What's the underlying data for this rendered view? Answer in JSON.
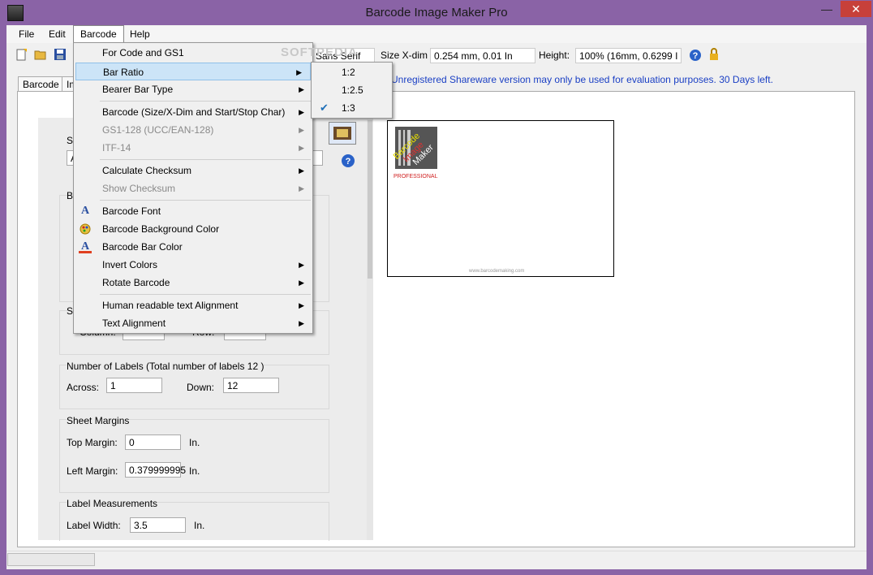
{
  "window": {
    "title": "Barcode Image Maker Pro",
    "minimize": "—",
    "maximize": "☐",
    "close": "✕"
  },
  "menubar": {
    "items": [
      "File",
      "Edit",
      "Barcode",
      "Help"
    ]
  },
  "toolbar": {
    "font_value": "Sans Serif",
    "size_label": "Size X-dim",
    "size_value": "0.254 mm, 0.01 In",
    "height_label": "Height:",
    "height_value": "100% (16mm, 0.6299 I"
  },
  "info_text": "Unregistered Shareware version may only be used for evaluation purposes. 30 Days left.",
  "tabs": [
    "Barcode",
    "Im"
  ],
  "left_panel": {
    "labels_group": {
      "title": "Number of Labels (Total number of labels 12 )",
      "across_label": "Across:",
      "across_value": "1",
      "down_label": "Down:",
      "down_value": "12"
    },
    "margins_group": {
      "title": "Sheet Margins",
      "top_label": "Top Margin:",
      "top_value": "0",
      "top_unit": "In.",
      "left_label": "Left Margin:",
      "left_value": "0.379999995",
      "left_unit": "In."
    },
    "measure_group": {
      "title": "Label Measurements",
      "width_label": "Label Width:",
      "width_value": "3.5",
      "width_unit": "In."
    },
    "partial": {
      "se": "Se",
      "a": "A",
      "ba": "Ba",
      "st": "St",
      "column": "Column:",
      "row": "Row:"
    }
  },
  "preview": {
    "logo_line1": "Barcode",
    "logo_line2": "Image",
    "logo_line3": "Maker",
    "logo_pro": "PROFESSIONAL",
    "footer": "www.barcodemaking.com"
  },
  "barcode_menu": {
    "items": [
      {
        "label": "For Code and GS1"
      },
      {
        "label": "Bar Ratio"
      },
      {
        "label": "Bearer Bar Type"
      },
      {
        "label": "Barcode (Size/X-Dim and Start/Stop Char)"
      },
      {
        "label": "GS1-128 (UCC/EAN-128)"
      },
      {
        "label": "ITF-14"
      },
      {
        "label": "Calculate Checksum"
      },
      {
        "label": "Show Checksum"
      },
      {
        "label": "Barcode Font"
      },
      {
        "label": "Barcode Background Color"
      },
      {
        "label": "Barcode Bar Color"
      },
      {
        "label": "Invert Colors"
      },
      {
        "label": "Rotate Barcode"
      },
      {
        "label": "Human readable text Alignment"
      },
      {
        "label": "Text Alignment"
      }
    ]
  },
  "bar_ratio_submenu": {
    "items": [
      "1:2",
      "1:2.5",
      "1:3"
    ],
    "checked": "1:3"
  },
  "watermark": "SOFTPEDIA",
  "colors": {
    "frame": "#8a63a6",
    "highlight": "#cce4f7",
    "info": "#1a3fc4"
  }
}
